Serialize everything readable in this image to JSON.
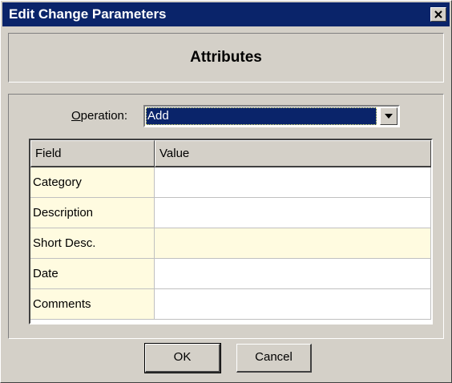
{
  "window": {
    "title": "Edit Change Parameters"
  },
  "header": {
    "title": "Attributes"
  },
  "operation": {
    "label_accel": "O",
    "label_rest": "peration:",
    "value": "Add"
  },
  "grid": {
    "columns": [
      "Field",
      "Value"
    ],
    "rows": [
      {
        "field": "Category",
        "value": ""
      },
      {
        "field": "Description",
        "value": ""
      },
      {
        "field": "Short Desc.",
        "value": ""
      },
      {
        "field": "Date",
        "value": ""
      },
      {
        "field": "Comments",
        "value": ""
      }
    ]
  },
  "buttons": {
    "ok": "OK",
    "cancel": "Cancel"
  },
  "colors": {
    "titlebar": "#0a246a",
    "face": "#d4d0c8",
    "field_bg": "#fffbe0"
  }
}
